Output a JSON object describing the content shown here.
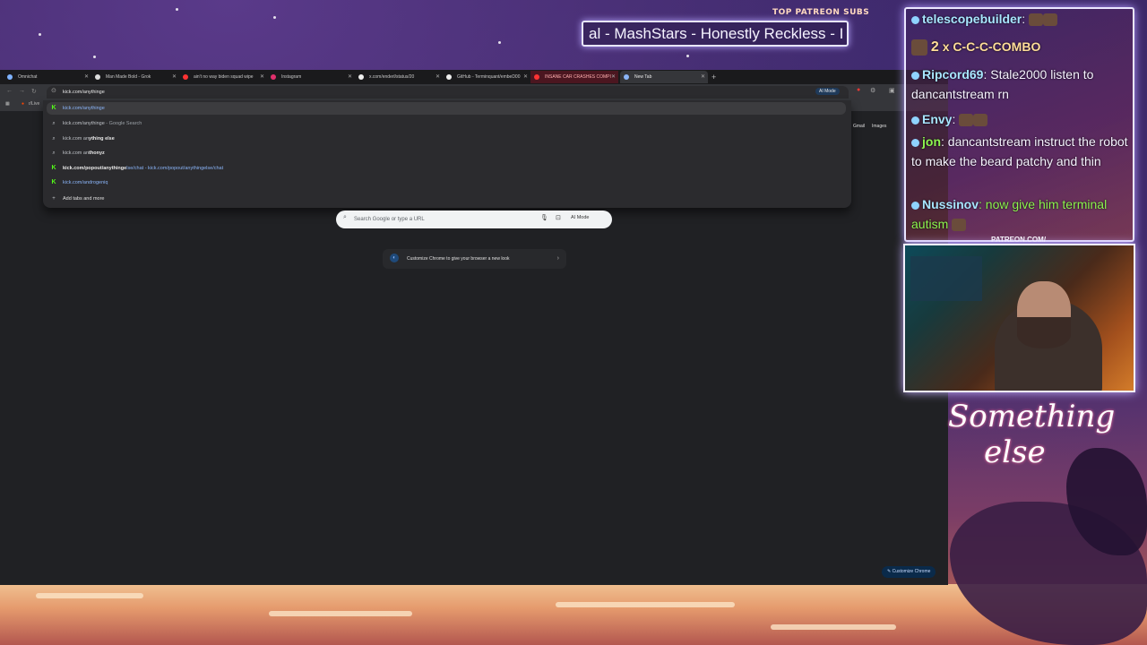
{
  "overlay": {
    "patreon_label": "TOP PATREON SUBS",
    "ticker_text": "al - MashStars - Honestly Reckless - I",
    "patreon_url": "PATREON.COM/",
    "logo_line1": "Something",
    "logo_line2": "else"
  },
  "tabs": [
    {
      "label": "Omnichat",
      "color": "#7fb3ff"
    },
    {
      "label": "Man Made Bold - Grok",
      "color": "#dddddd"
    },
    {
      "label": "ain't no way biden squad wipe",
      "color": "#ff3333"
    },
    {
      "label": "Instagram",
      "color": "#e1306c"
    },
    {
      "label": "x.com/enderl/status/20",
      "color": "#eeeeee"
    },
    {
      "label": "GitHub - Terminquant/embeD00",
      "color": "#eeeeee"
    },
    {
      "label": "INSANE CAR CRASHES COMPI",
      "color": "#ff3333"
    },
    {
      "label": "New Tab",
      "color": "#8ab4f8"
    }
  ],
  "toolbar": {
    "omnibox_value": "kick.com/anythinge",
    "ai_mode_label": "AI Mode"
  },
  "bookmarks": {
    "first": "r/Live"
  },
  "suggestions": [
    {
      "pre": "",
      "main": "kick.com/anythinge",
      "suffix": ""
    },
    {
      "pre": "kick.com/anythinge",
      "main": "",
      "suffix": " - Google Search"
    },
    {
      "pre": "kick.com an",
      "main": "ything else",
      "suffix": ""
    },
    {
      "pre": "kick.com an",
      "main": "thonyz",
      "suffix": ""
    },
    {
      "pre": "kick.com/popout/",
      "main": "anythinge",
      "suffix": "lse/chat - kick.com/popout/anythingelse/chat"
    },
    {
      "pre": "",
      "main": "kick.com/androgeniq",
      "suffix": ""
    }
  ],
  "add_tabs_label": "Add tabs and more",
  "header_links": {
    "gmail": "Gmail",
    "images": "Images"
  },
  "search": {
    "placeholder": "Search Google or type a URL",
    "ai_mode": "AI Mode"
  },
  "customize_card": {
    "text": "Customize Chrome to give your browser a new look"
  },
  "customize_button": "Customize Chrome",
  "chat": [
    {
      "user": "telescopebuilder",
      "text": ":"
    },
    {
      "combo_count": "2",
      "combo_text": "x C-C-C-COMBO"
    },
    {
      "user": "Ripcord69",
      "text": ": Stale2000 listen to dancantstream rn"
    },
    {
      "user": "Envy",
      "text": ":"
    },
    {
      "user": "jon",
      "text": ": dancantstream instruct the robot to make the beard patchy and thin"
    },
    {
      "user": "Nussinov",
      "text": ": now give him terminal autism"
    }
  ],
  "colors": {
    "kick_green": "#53fc18",
    "link_blue": "#8ab4f8",
    "browser_bg": "#202124"
  }
}
